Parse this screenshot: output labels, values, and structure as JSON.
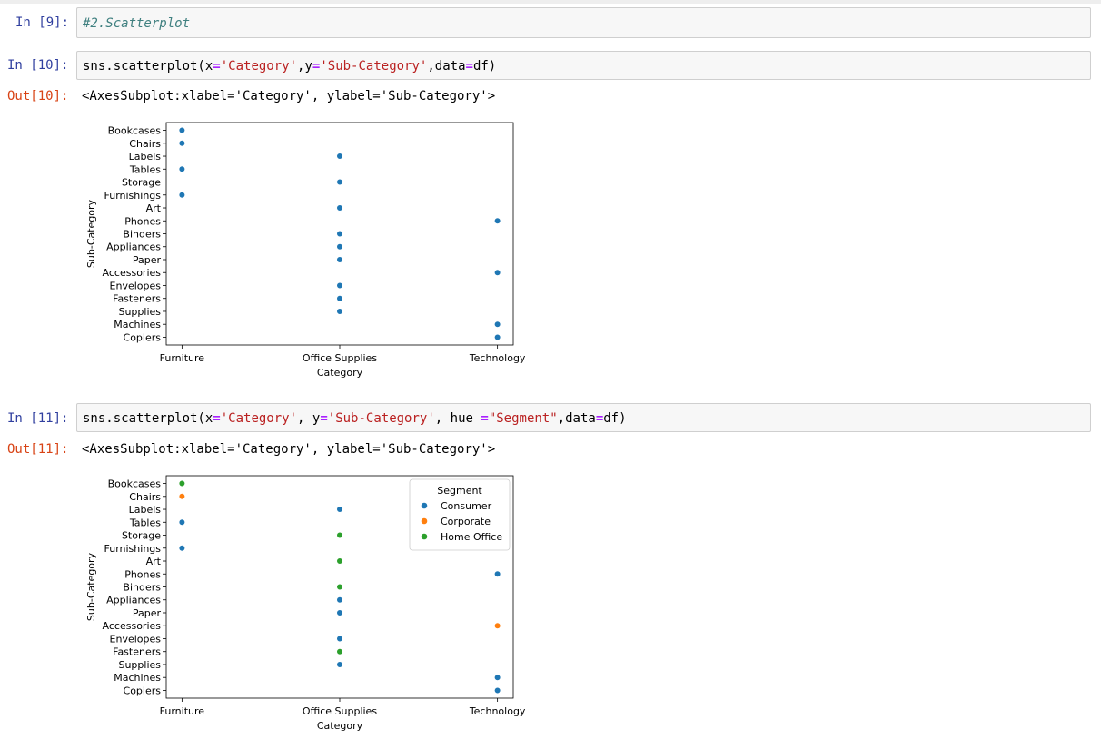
{
  "cells": [
    {
      "prompt": "In [9]:",
      "code": {
        "comment": "#2.Scatterplot"
      }
    },
    {
      "prompt": "In [10]:",
      "code": {
        "fn": "sns.scatterplot(",
        "a1": "x",
        "eq": "=",
        "s1": "'Category'",
        "c1": ",",
        "a2": "y",
        "s2": "'Sub-Category'",
        "c2": ",",
        "a3": "data",
        "tail": "df)"
      },
      "out_prompt": "Out[10]:",
      "output": "<AxesSubplot:xlabel='Category', ylabel='Sub-Category'>"
    },
    {
      "prompt": "In [11]:",
      "code": {
        "fn": "sns.scatterplot(",
        "a1": "x",
        "eq": "=",
        "s1": "'Category'",
        "c1": ", ",
        "a2": "y",
        "s2": "'Sub-Category'",
        "c2": ", ",
        "a3": "hue ",
        "s3": "\"Segment\"",
        "c3": ",",
        "a4": "data",
        "tail": "df)"
      },
      "out_prompt": "Out[11]:",
      "output": "<AxesSubplot:xlabel='Category', ylabel='Sub-Category'>"
    }
  ],
  "chart_data": [
    {
      "type": "scatter",
      "xlabel": "Category",
      "ylabel": "Sub-Category",
      "x_categories": [
        "Furniture",
        "Office Supplies",
        "Technology"
      ],
      "y_categories": [
        "Bookcases",
        "Chairs",
        "Labels",
        "Tables",
        "Storage",
        "Furnishings",
        "Art",
        "Phones",
        "Binders",
        "Appliances",
        "Paper",
        "Accessories",
        "Envelopes",
        "Fasteners",
        "Supplies",
        "Machines",
        "Copiers"
      ],
      "grid": false,
      "colors": {
        "default": "#1f77b4"
      },
      "points": [
        {
          "x": "Furniture",
          "y": "Bookcases"
        },
        {
          "x": "Furniture",
          "y": "Chairs"
        },
        {
          "x": "Office Supplies",
          "y": "Labels"
        },
        {
          "x": "Furniture",
          "y": "Tables"
        },
        {
          "x": "Office Supplies",
          "y": "Storage"
        },
        {
          "x": "Furniture",
          "y": "Furnishings"
        },
        {
          "x": "Office Supplies",
          "y": "Art"
        },
        {
          "x": "Technology",
          "y": "Phones"
        },
        {
          "x": "Office Supplies",
          "y": "Binders"
        },
        {
          "x": "Office Supplies",
          "y": "Appliances"
        },
        {
          "x": "Office Supplies",
          "y": "Paper"
        },
        {
          "x": "Technology",
          "y": "Accessories"
        },
        {
          "x": "Office Supplies",
          "y": "Envelopes"
        },
        {
          "x": "Office Supplies",
          "y": "Fasteners"
        },
        {
          "x": "Office Supplies",
          "y": "Supplies"
        },
        {
          "x": "Technology",
          "y": "Machines"
        },
        {
          "x": "Technology",
          "y": "Copiers"
        }
      ]
    },
    {
      "type": "scatter",
      "xlabel": "Category",
      "ylabel": "Sub-Category",
      "x_categories": [
        "Furniture",
        "Office Supplies",
        "Technology"
      ],
      "y_categories": [
        "Bookcases",
        "Chairs",
        "Labels",
        "Tables",
        "Storage",
        "Furnishings",
        "Art",
        "Phones",
        "Binders",
        "Appliances",
        "Paper",
        "Accessories",
        "Envelopes",
        "Fasteners",
        "Supplies",
        "Machines",
        "Copiers"
      ],
      "grid": false,
      "legend": {
        "title": "Segment",
        "placement": "top-right",
        "entries": [
          {
            "name": "Consumer",
            "color": "#1f77b4"
          },
          {
            "name": "Corporate",
            "color": "#ff7f0e"
          },
          {
            "name": "Home Office",
            "color": "#2ca02c"
          }
        ]
      },
      "points": [
        {
          "x": "Furniture",
          "y": "Bookcases",
          "hue": "Home Office"
        },
        {
          "x": "Furniture",
          "y": "Chairs",
          "hue": "Corporate"
        },
        {
          "x": "Office Supplies",
          "y": "Labels",
          "hue": "Consumer"
        },
        {
          "x": "Furniture",
          "y": "Tables",
          "hue": "Consumer"
        },
        {
          "x": "Office Supplies",
          "y": "Storage",
          "hue": "Home Office"
        },
        {
          "x": "Furniture",
          "y": "Furnishings",
          "hue": "Consumer"
        },
        {
          "x": "Office Supplies",
          "y": "Art",
          "hue": "Home Office"
        },
        {
          "x": "Technology",
          "y": "Phones",
          "hue": "Consumer"
        },
        {
          "x": "Office Supplies",
          "y": "Binders",
          "hue": "Home Office"
        },
        {
          "x": "Office Supplies",
          "y": "Appliances",
          "hue": "Consumer"
        },
        {
          "x": "Office Supplies",
          "y": "Paper",
          "hue": "Consumer"
        },
        {
          "x": "Technology",
          "y": "Accessories",
          "hue": "Corporate"
        },
        {
          "x": "Office Supplies",
          "y": "Envelopes",
          "hue": "Consumer"
        },
        {
          "x": "Office Supplies",
          "y": "Fasteners",
          "hue": "Home Office"
        },
        {
          "x": "Office Supplies",
          "y": "Supplies",
          "hue": "Consumer"
        },
        {
          "x": "Technology",
          "y": "Machines",
          "hue": "Consumer"
        },
        {
          "x": "Technology",
          "y": "Copiers",
          "hue": "Consumer"
        }
      ]
    }
  ]
}
